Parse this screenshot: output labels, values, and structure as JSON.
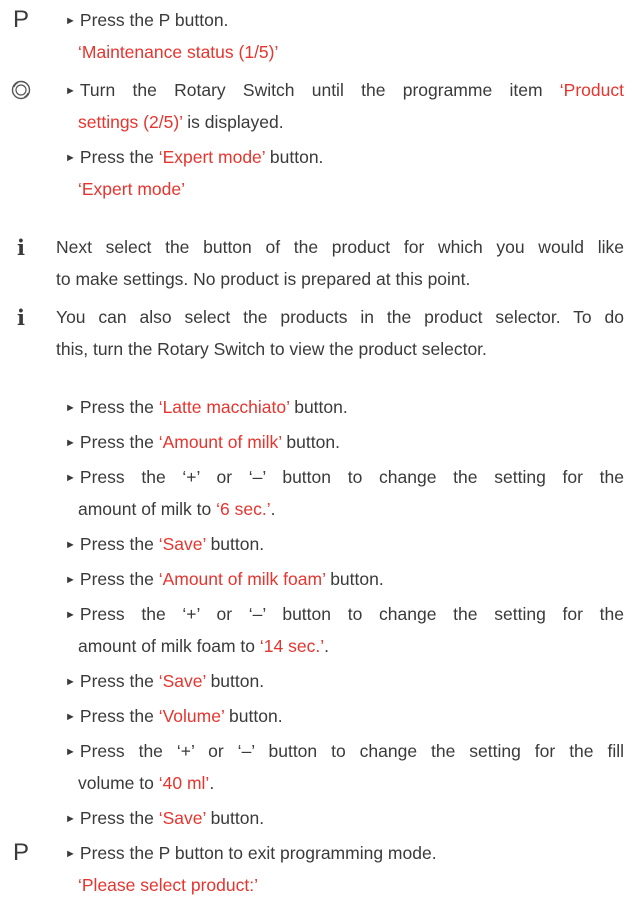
{
  "icons": {
    "p_button": "P",
    "info": "i",
    "rotary": "rotary-switch-icon"
  },
  "steps": {
    "s1": {
      "lead": "Press the P button.",
      "result": "‘Maintenance status (1/5)’"
    },
    "s2": {
      "pre": "Turn the Rotary Switch until the programme item ",
      "item1": "‘Product",
      "item2": "settings (2/5)’",
      "post": " is displayed."
    },
    "s3": {
      "pre": "Press the ",
      "btn": "‘Expert mode’",
      "post": " button.",
      "result": "‘Expert mode’"
    },
    "info1": {
      "line1": "Next select the button of the product for which you would like",
      "line2": "to make settings. No product is prepared at this point."
    },
    "info2": {
      "line1": "You can also select the products in the product selector. To do",
      "line2": "this, turn the Rotary Switch to view the product selector."
    },
    "s4": {
      "pre": "Press the ",
      "btn": "‘Latte macchiato’",
      "post": " button."
    },
    "s5": {
      "pre": "Press the ",
      "btn": "‘Amount of milk’",
      "post": " button."
    },
    "s6": {
      "line1": "Press the ‘+’ or ‘–’ button to change the setting for the",
      "pre2": "amount of milk to ",
      "val": "‘6 sec.’",
      "post2": "."
    },
    "s7": {
      "pre": "Press the ",
      "btn": "‘Save’",
      "post": " button."
    },
    "s8": {
      "pre": "Press the ",
      "btn": "‘Amount of milk foam’",
      "post": " button."
    },
    "s9": {
      "line1": "Press the ‘+’ or ‘–’ button to change the setting for the",
      "pre2": "amount of milk foam to ",
      "val": "‘14 sec.’",
      "post2": "."
    },
    "s10": {
      "pre": "Press the ",
      "btn": "‘Save’",
      "post": " button."
    },
    "s11": {
      "pre": "Press the ",
      "btn": "‘Volume’",
      "post": " button."
    },
    "s12": {
      "line1": "Press the ‘+’ or ‘–’ button to change the setting for the fill",
      "pre2": "volume to ",
      "val": "‘40 ml’",
      "post2": "."
    },
    "s13": {
      "pre": "Press the ",
      "btn": "‘Save’",
      "post": " button."
    },
    "s14": {
      "lead": "Press the P button to exit programming mode.",
      "result": "‘Please select product:’"
    }
  }
}
